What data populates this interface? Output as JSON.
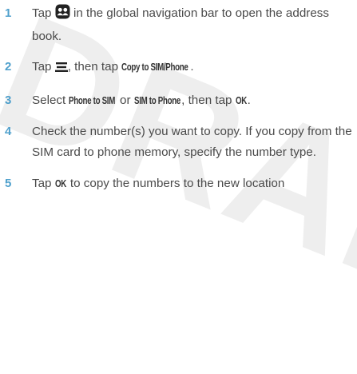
{
  "watermark": "DRAFT",
  "steps": [
    {
      "number": "1",
      "text_before": "Tap ",
      "icon": "contacts-book-icon",
      "text_after": " in the global navigation bar to open the address book."
    },
    {
      "number": "2",
      "text_before": "Tap ",
      "icon": "menu-icon",
      "text_middle": ", then tap ",
      "command": "Copy to SIM/Phone",
      "text_after": "."
    },
    {
      "number": "3",
      "text_before": "Select ",
      "command1": "Phone to SIM",
      "text_middle1": " or ",
      "command2": "SIM to Phone",
      "text_middle2": ", then tap ",
      "command3": "OK",
      "text_after": "."
    },
    {
      "number": "4",
      "text": "Check the number(s) you want to copy. If you copy from the SIM card to phone memory, specify the number type."
    },
    {
      "number": "5",
      "text_before": "Tap ",
      "command": "OK",
      "text_after": " to copy the numbers to the new location"
    }
  ]
}
